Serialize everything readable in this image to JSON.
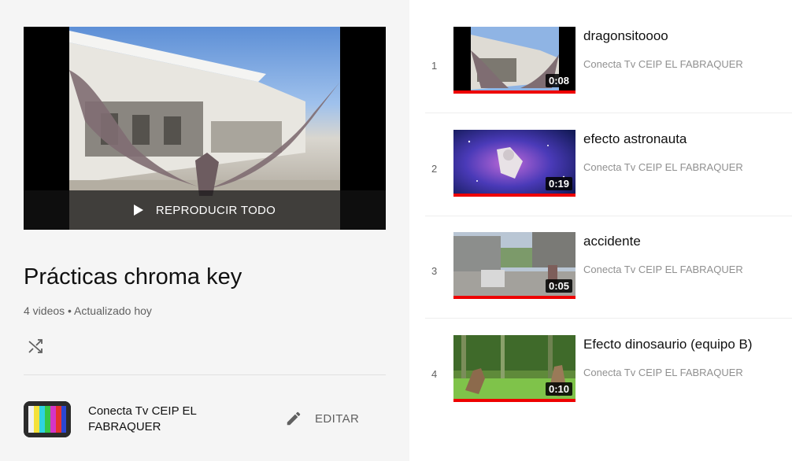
{
  "playlist": {
    "play_all_label": "REPRODUCIR TODO",
    "title": "Prácticas chroma key",
    "meta": "4 videos • Actualizado hoy",
    "owner_name": "Conecta Tv CEIP EL FABRAQUER",
    "edit_label": "EDITAR"
  },
  "videos": [
    {
      "index": "1",
      "title": "dragonsitoooo",
      "channel": "Conecta Tv CEIP EL FABRAQUER",
      "duration": "0:08"
    },
    {
      "index": "2",
      "title": "efecto astronauta",
      "channel": "Conecta Tv CEIP EL FABRAQUER",
      "duration": "0:19"
    },
    {
      "index": "3",
      "title": "accidente",
      "channel": "Conecta Tv CEIP EL FABRAQUER",
      "duration": "0:05"
    },
    {
      "index": "4",
      "title": "Efecto dinosaurio (equipo B)",
      "channel": "Conecta Tv CEIP EL FABRAQUER",
      "duration": "0:10"
    }
  ],
  "icons": {
    "play": "play-icon",
    "shuffle": "shuffle-icon",
    "edit": "pencil-icon",
    "avatar": "tv-color-bars-icon"
  },
  "colors": {
    "progress_bar": "#ee0000",
    "panel_bg": "#f5f5f5"
  }
}
